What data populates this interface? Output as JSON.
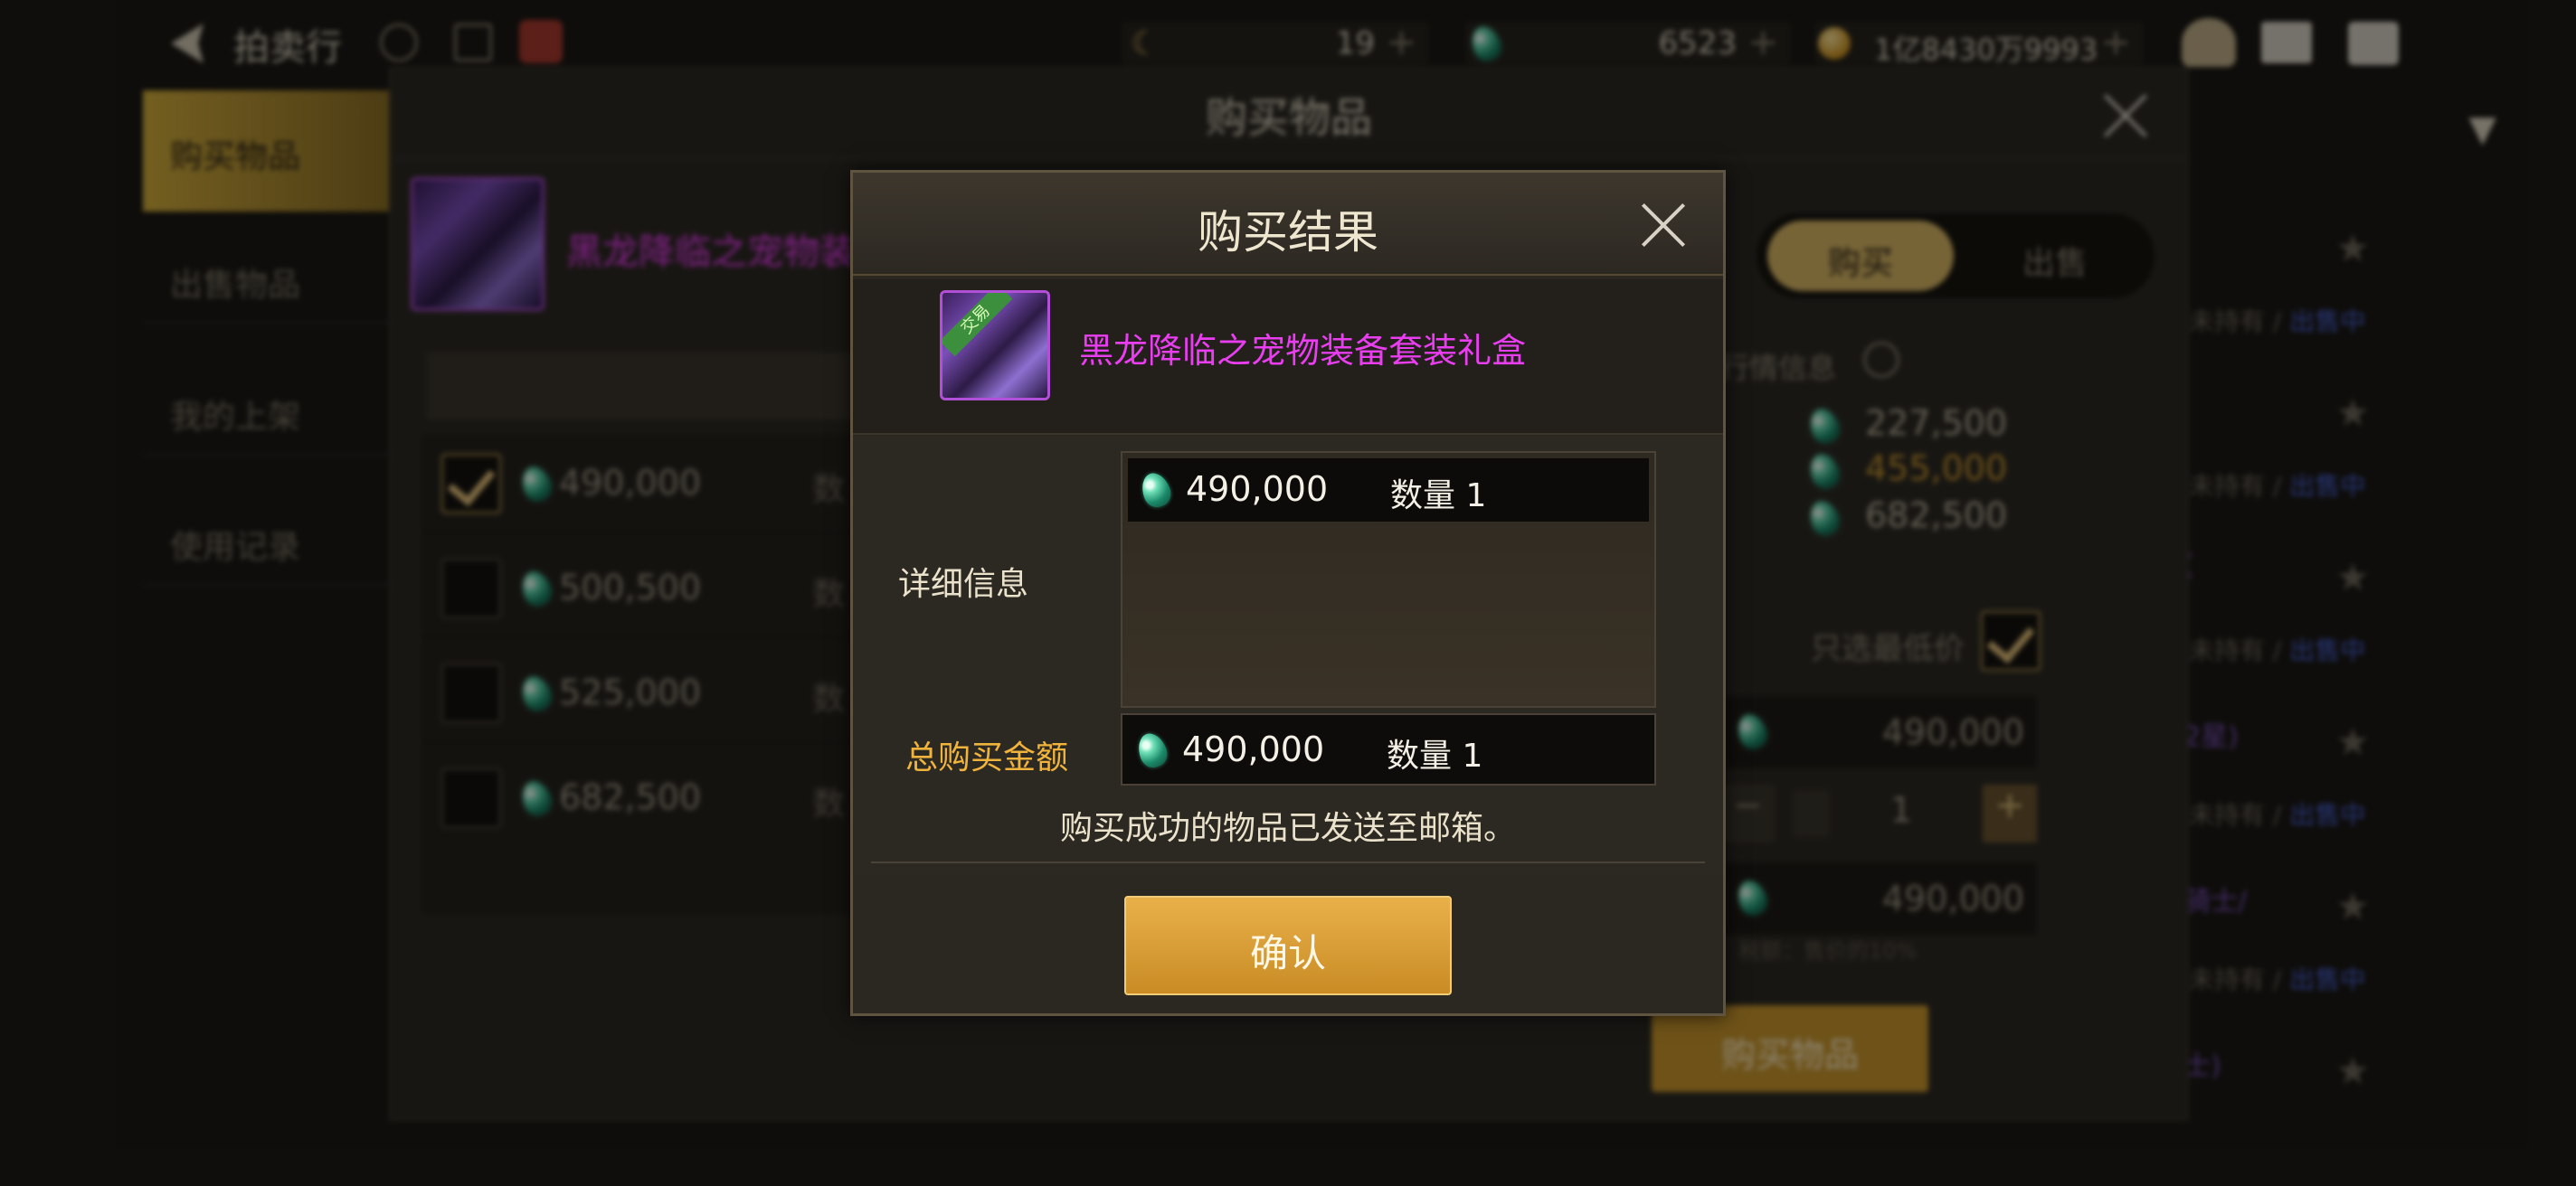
{
  "topbar": {
    "title": "拍卖行",
    "currency_moon": "19",
    "currency_gem": "6523",
    "currency_gold": "1亿8430万9993"
  },
  "sidebar": {
    "items": [
      {
        "label": "购买物品"
      },
      {
        "label": "出售物品"
      },
      {
        "label": "我的上架"
      },
      {
        "label": "使用记录"
      }
    ]
  },
  "bg_panel": {
    "title": "购买物品",
    "item_name": "黑龙降临之宠物装",
    "list": [
      {
        "price": "490,000",
        "checked": true
      },
      {
        "price": "500,500",
        "checked": false
      },
      {
        "price": "525,000",
        "checked": false
      },
      {
        "price": "682,500",
        "checked": false
      }
    ],
    "qty_label": "数",
    "toggle_buy": "购买",
    "toggle_sell": "出售",
    "market_label": "行情信息",
    "market_prices": [
      "227,500",
      "455,000",
      "682,500"
    ],
    "lowest_only_label": "只选最低价",
    "unit_price": "490,000",
    "quantity": "1",
    "total_price": "490,000",
    "fee_note": "税额：售价的10%",
    "buy_button": "购买物品"
  },
  "right_list": {
    "status_owned": "未持有",
    "status_sep": "/",
    "status_selling": "出售中",
    "snippets": [
      "(",
      "2星)",
      "骑士/",
      "士)"
    ]
  },
  "modal": {
    "title": "购买结果",
    "item_name": "黑龙降临之宠物装备套装礼盒",
    "item_tag": "交易",
    "detail_label": "详细信息",
    "detail_price": "490,000",
    "detail_qty": "数量 1",
    "total_label": "总购买金额",
    "total_price": "490,000",
    "total_qty": "数量 1",
    "mail_notice": "购买成功的物品已发送至邮箱。",
    "confirm_label": "确认"
  },
  "colors": {
    "gold_accent": "#e9b04a",
    "magenta_name": "#e93ef0",
    "total_label": "#f0b43c",
    "selling_blue": "#4a63d8"
  }
}
